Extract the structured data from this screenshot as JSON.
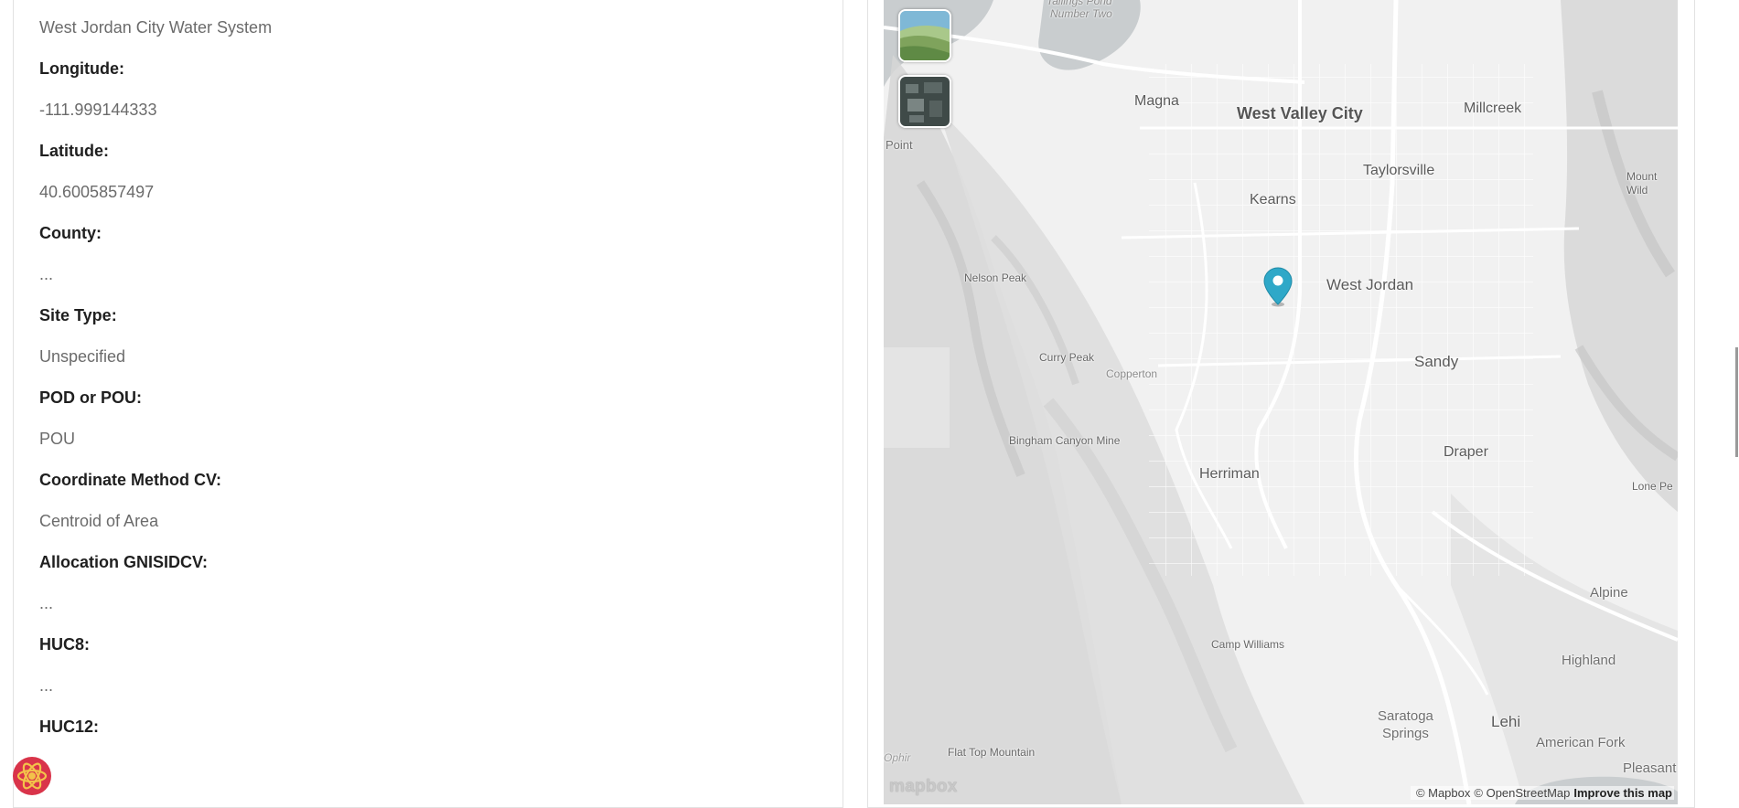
{
  "fields": [
    {
      "value": "West Jordan City Water System"
    },
    {
      "label": "Longitude:",
      "value": "-111.999144333"
    },
    {
      "label": "Latitude:",
      "value": "40.6005857497"
    },
    {
      "label": "County:",
      "value": "..."
    },
    {
      "label": "Site Type:",
      "value": "Unspecified"
    },
    {
      "label": "POD or POU:",
      "value": "POU"
    },
    {
      "label": "Coordinate Method CV:",
      "value": "Centroid of Area"
    },
    {
      "label": "Allocation GNISIDCV:",
      "value": "..."
    },
    {
      "label": "HUC8:",
      "value": "..."
    },
    {
      "label": "HUC12:"
    }
  ],
  "map": {
    "places": {
      "tailings_pond": "Tailings Pond",
      "number_two": "Number Two",
      "magna": "Magna",
      "west_valley_city": "West Valley City",
      "millcreek": "Millcreek",
      "point": "Point",
      "taylorsville": "Taylorsville",
      "mount_wild": "Mount\nWild",
      "kearns": "Kearns",
      "nelson_peak": "Nelson Peak",
      "west_jordan": "West Jordan",
      "sandy": "Sandy",
      "curry_peak": "Curry Peak",
      "copperton": "Copperton",
      "bingham_canyon_mine": "Bingham Canyon Mine",
      "draper": "Draper",
      "herriman": "Herriman",
      "lone_peak": "Lone Pe",
      "alpine": "Alpine",
      "camp_williams": "Camp Williams",
      "highland": "Highland",
      "saratoga_springs": "Saratoga\nSprings",
      "lehi": "Lehi",
      "american_fork": "American Fork",
      "flat_top_mountain": "Flat Top Mountain",
      "ophir": "Ophir",
      "pleasant": "Pleasant"
    },
    "logo": "mapbox",
    "attribution": {
      "mapbox": "© Mapbox",
      "osm": "© OpenStreetMap",
      "improve": "Improve this map"
    },
    "layer_buttons": [
      "terrain-layer",
      "satellite-layer"
    ],
    "marker_color": "#2fa8c8",
    "marker_location": {
      "longitude": -111.999144333,
      "latitude": 40.6005857497
    }
  },
  "colors": {
    "label": "#1f1f1f",
    "value": "#6b6b6b",
    "map_background": "#f0f0f0"
  }
}
